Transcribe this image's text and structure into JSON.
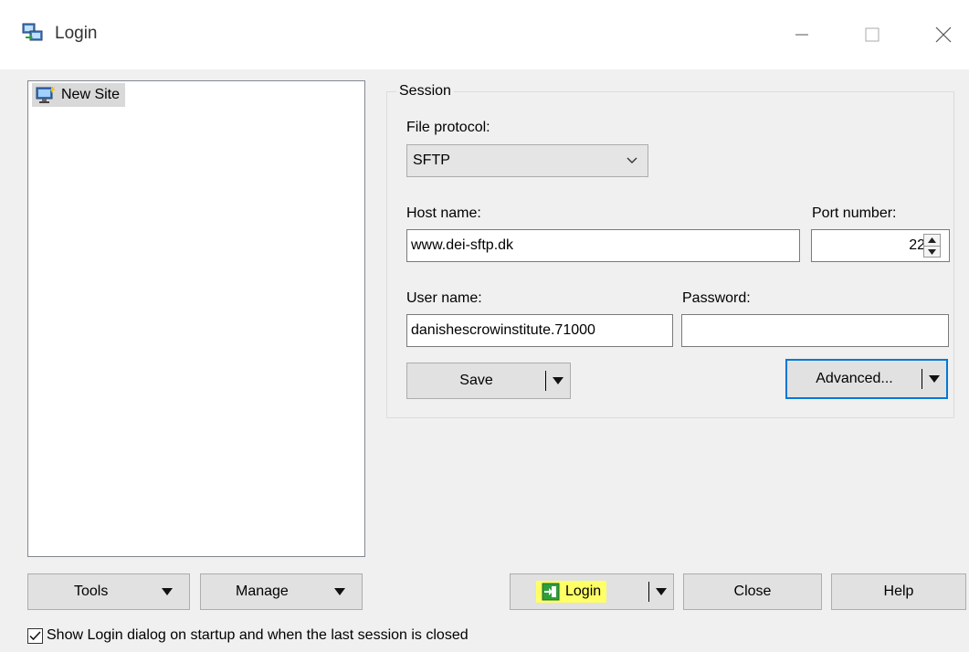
{
  "window": {
    "title": "Login",
    "icon": "winscp-login-icon",
    "controls": [
      "minimize-icon",
      "maximize-icon",
      "close-icon"
    ]
  },
  "site_tree": {
    "items": [
      {
        "label": "New Site",
        "icon": "computer-new-site-icon",
        "selected": true
      }
    ]
  },
  "session": {
    "legend": "Session",
    "file_protocol_label": "File protocol:",
    "file_protocol_value": "SFTP",
    "host_label": "Host name:",
    "host_value": "www.dei-sftp.dk",
    "port_label": "Port number:",
    "port_value": "22",
    "user_label": "User name:",
    "user_value": "danishescrowinstitute.71000",
    "password_label": "Password:",
    "password_value": "",
    "save_label": "Save",
    "advanced_label": "Advanced..."
  },
  "bottom": {
    "tools_label": "Tools",
    "manage_label": "Manage",
    "login_label": "Login",
    "close_label": "Close",
    "help_label": "Help",
    "startup_checkbox_label": "Show Login dialog on startup and when the last session is closed",
    "startup_checkbox_checked": true
  },
  "colors": {
    "focus_border": "#0078d7",
    "highlight": "#ffff66",
    "login_icon": "#2e9e3a"
  }
}
